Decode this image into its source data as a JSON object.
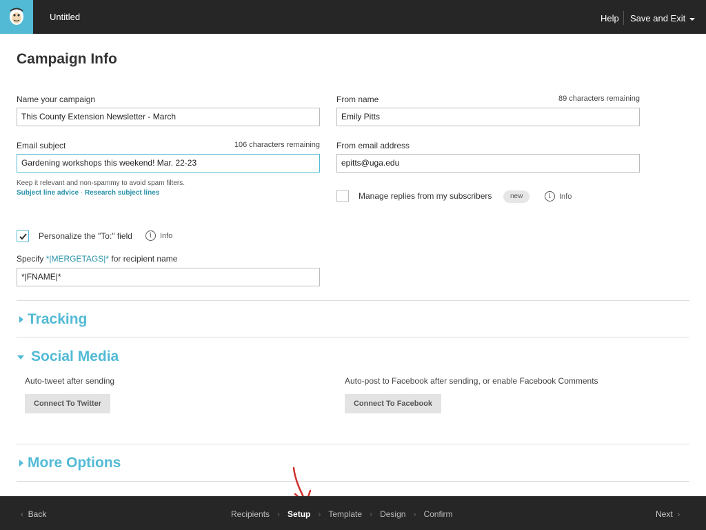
{
  "header": {
    "title": "Untitled",
    "help_label": "Help",
    "save_exit_label": "Save and Exit",
    "logo_icon": "chimp-logo-icon"
  },
  "page": {
    "title": "Campaign Info"
  },
  "campaign_name": {
    "label": "Name your campaign",
    "value": "This County Extension Newsletter - March"
  },
  "email_subject": {
    "label": "Email subject",
    "counter": "106 characters remaining",
    "value": "Gardening workshops this weekend! Mar. 22-23",
    "hint": "Keep it relevant and non-spammy to avoid spam filters.",
    "link_advice": "Subject line advice",
    "link_sep": " · ",
    "link_research": "Research subject lines"
  },
  "from_name": {
    "label": "From name",
    "counter": "89 characters remaining",
    "value": "Emily Pitts"
  },
  "from_email": {
    "label": "From email address",
    "value": "epitts@uga.edu"
  },
  "manage_replies": {
    "label": "Manage replies from my subscribers",
    "badge": "new",
    "info": "Info",
    "checked": false
  },
  "personalize": {
    "label": "Personalize the \"To:\" field",
    "info": "Info",
    "checked": true,
    "specify_prefix": "Specify ",
    "specify_tag": "*|MERGETAGS|*",
    "specify_suffix": " for recipient name",
    "value": "*|FNAME|*"
  },
  "sections": {
    "tracking": "Tracking",
    "social": "Social Media",
    "more": "More Options"
  },
  "social": {
    "twitter_label": "Auto-tweet after sending",
    "twitter_button": "Connect To Twitter",
    "facebook_label": "Auto-post to Facebook after sending, or enable Facebook Comments",
    "facebook_button": "Connect To Facebook"
  },
  "footer": {
    "back": "Back",
    "next": "Next",
    "steps": [
      "Recipients",
      "Setup",
      "Template",
      "Design",
      "Confirm"
    ],
    "active_step": "Setup"
  },
  "colors": {
    "accent": "#52bad5",
    "dark_bar": "#262626",
    "annotation_arrow": "#d0312d"
  }
}
